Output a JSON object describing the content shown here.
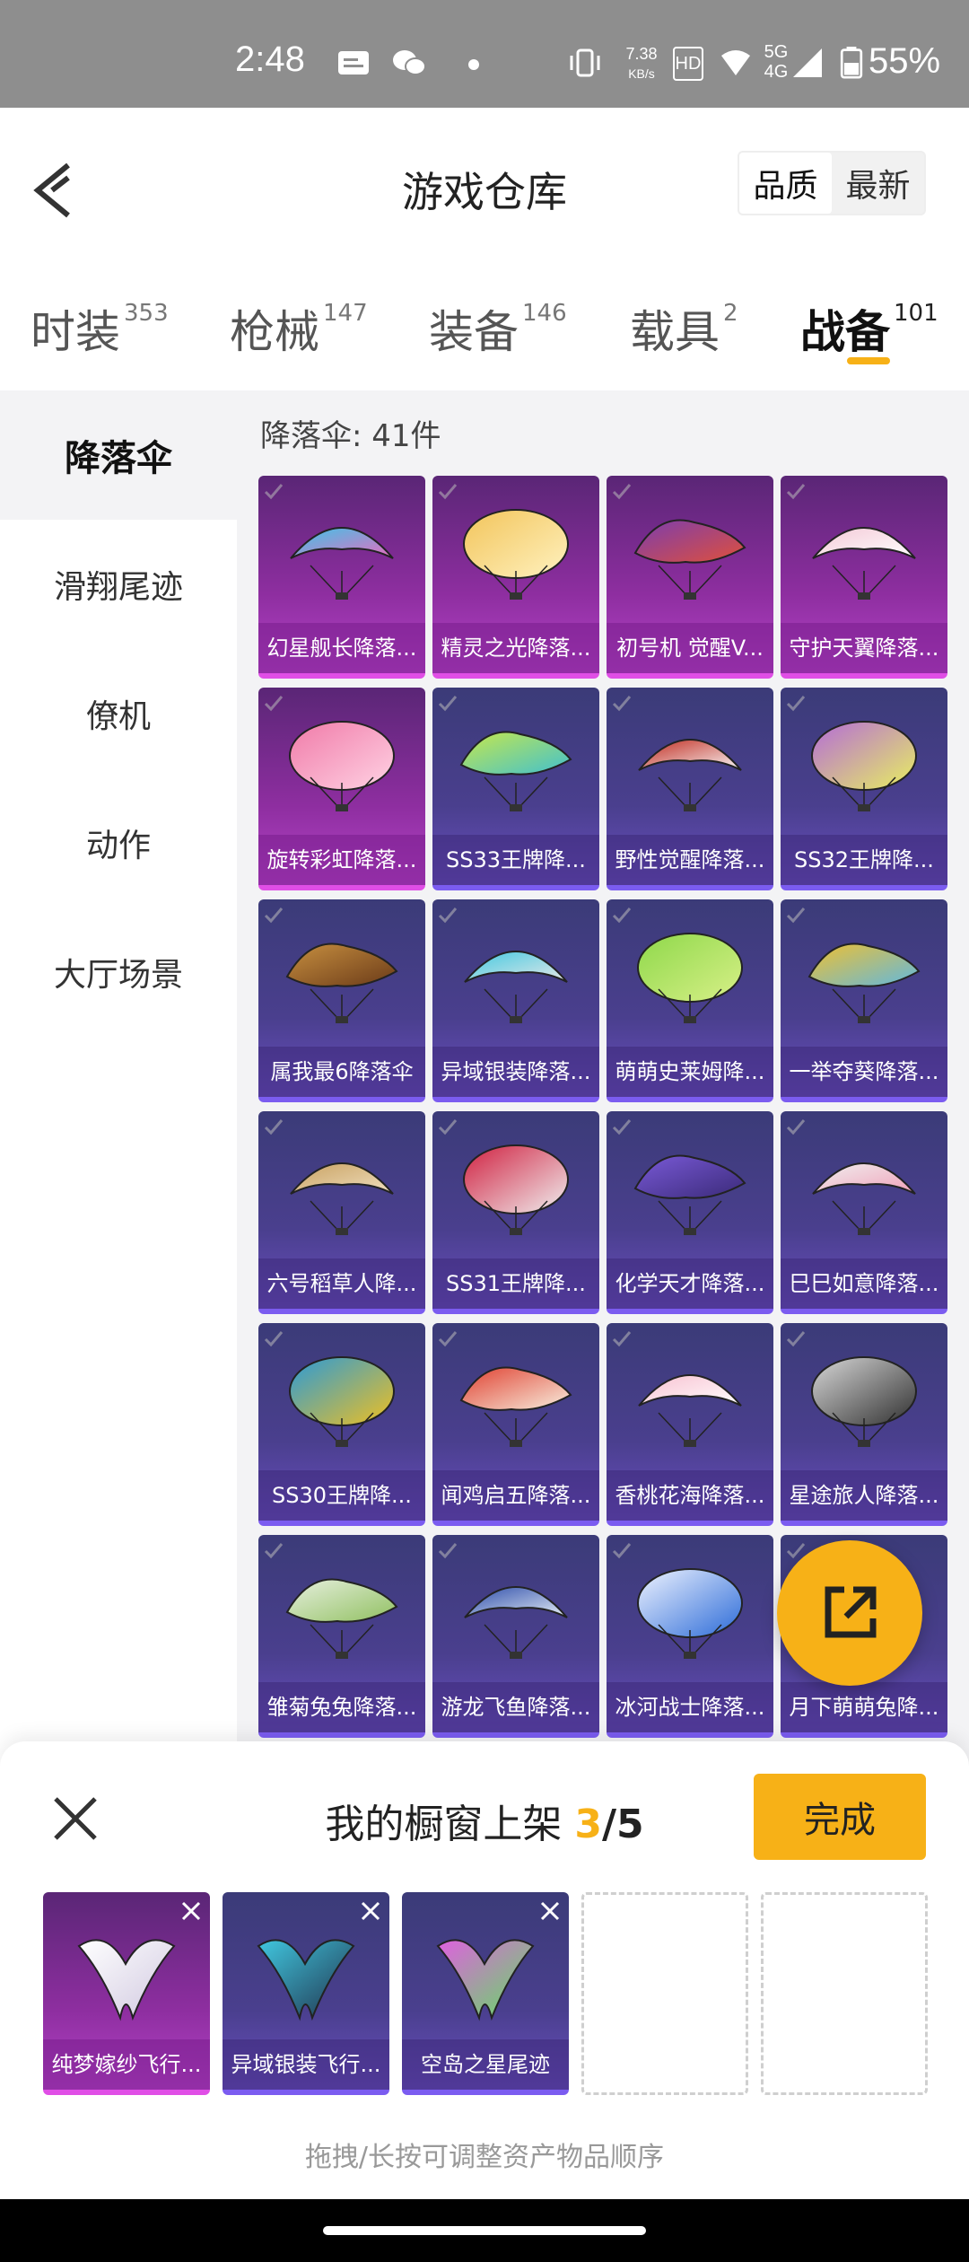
{
  "status_bar": {
    "time": "2:48",
    "net_speed_value": "7.38",
    "net_speed_unit": "KB/s",
    "sim": "HD",
    "network": "5G",
    "network2": "4G",
    "battery": "55%",
    "icons": [
      "message-icon",
      "wechat-icon",
      "dot-icon",
      "vibrate-icon",
      "wifi-icon",
      "signal-icon",
      "battery-icon"
    ]
  },
  "header": {
    "title": "游戏仓库",
    "sort": {
      "options": [
        "品质",
        "最新"
      ],
      "selected": "品质"
    }
  },
  "tabs": [
    {
      "label": "时装",
      "count": "353"
    },
    {
      "label": "枪械",
      "count": "147"
    },
    {
      "label": "装备",
      "count": "146"
    },
    {
      "label": "载具",
      "count": "2"
    },
    {
      "label": "战备",
      "count": "101",
      "active": true
    }
  ],
  "sidebar": {
    "items": [
      {
        "label": "降落伞",
        "active": true
      },
      {
        "label": "滑翔尾迹"
      },
      {
        "label": "僚机"
      },
      {
        "label": "动作"
      },
      {
        "label": "大厅场景"
      }
    ]
  },
  "list": {
    "count_label": "降落伞: 41件",
    "items": [
      {
        "name": "幻星舰长降落...",
        "rarity": "purple",
        "c1": "#3ac6e8",
        "c2": "#e86cc0"
      },
      {
        "name": "精灵之光降落...",
        "rarity": "purple",
        "c1": "#f2c45a",
        "c2": "#fff2c0"
      },
      {
        "name": "初号机 觉醒V...",
        "rarity": "purple",
        "c1": "#7a3db0",
        "c2": "#e0503a"
      },
      {
        "name": "守护天翼降落...",
        "rarity": "purple",
        "c1": "#f3c8d6",
        "c2": "#ffffff"
      },
      {
        "name": "旋转彩虹降落...",
        "rarity": "purple",
        "c1": "#f07aa8",
        "c2": "#ffd3e4"
      },
      {
        "name": "SS33王牌降...",
        "rarity": "blue",
        "c1": "#c8e84a",
        "c2": "#40c0d0"
      },
      {
        "name": "野性觉醒降落...",
        "rarity": "blue",
        "c1": "#c0281c",
        "c2": "#f8f8f8"
      },
      {
        "name": "SS32王牌降...",
        "rarity": "blue",
        "c1": "#b46bd8",
        "c2": "#e8f060"
      },
      {
        "name": "属我最6降落伞",
        "rarity": "blue",
        "c1": "#c89040",
        "c2": "#6a3a18"
      },
      {
        "name": "异域银装降落...",
        "rarity": "blue",
        "c1": "#40c8e0",
        "c2": "#e8e8e8"
      },
      {
        "name": "萌萌史莱姆降...",
        "rarity": "blue",
        "c1": "#8ed84a",
        "c2": "#d8f088"
      },
      {
        "name": "一举夺葵降落...",
        "rarity": "blue",
        "c1": "#f0c030",
        "c2": "#60b8e0"
      },
      {
        "name": "六号稻草人降...",
        "rarity": "blue",
        "c1": "#c8a060",
        "c2": "#f0e0c0"
      },
      {
        "name": "SS31王牌降...",
        "rarity": "blue",
        "c1": "#d02040",
        "c2": "#f0f0f0"
      },
      {
        "name": "化学天才降落...",
        "rarity": "blue",
        "c1": "#7a5ad8",
        "c2": "#3a2a78"
      },
      {
        "name": "巳巳如意降落...",
        "rarity": "blue",
        "c1": "#f0f0f0",
        "c2": "#f0a0b8"
      },
      {
        "name": "SS30王牌降...",
        "rarity": "blue",
        "c1": "#2a9ad8",
        "c2": "#f0c020"
      },
      {
        "name": "闻鸡启五降落...",
        "rarity": "blue",
        "c1": "#e04030",
        "c2": "#f8f0e0"
      },
      {
        "name": "香桃花海降落...",
        "rarity": "blue",
        "c1": "#f8c0d0",
        "c2": "#ffffff"
      },
      {
        "name": "星途旅人降落...",
        "rarity": "blue",
        "c1": "#d8d8d8",
        "c2": "#303030"
      },
      {
        "name": "雏菊兔兔降落...",
        "rarity": "blue",
        "c1": "#e8f0e0",
        "c2": "#90c060"
      },
      {
        "name": "游龙飞鱼降落...",
        "rarity": "blue",
        "c1": "#2a4aa8",
        "c2": "#e8f0f8"
      },
      {
        "name": "冰河战士降落...",
        "rarity": "blue",
        "c1": "#f0f4ff",
        "c2": "#2a6ad8"
      },
      {
        "name": "月下萌萌兔降...",
        "rarity": "blue",
        "c1": "#5a4aa8",
        "c2": "#e0d8f0"
      }
    ]
  },
  "showcase": {
    "title": "我的橱窗上架",
    "current": "3",
    "total": "/5",
    "done_label": "完成",
    "hint": "拖拽/长按可调整资产物品顺序",
    "slots": [
      {
        "name": "纯梦嫁纱飞行...",
        "rarity": "purple",
        "c1": "#ffffff",
        "c2": "#d0c8e0"
      },
      {
        "name": "异域银装飞行...",
        "rarity": "blue",
        "c1": "#40c8e0",
        "c2": "#20304a"
      },
      {
        "name": "空岛之星尾迹",
        "rarity": "blue",
        "c1": "#e060e0",
        "c2": "#60e060"
      }
    ],
    "empty_slots": 2
  }
}
